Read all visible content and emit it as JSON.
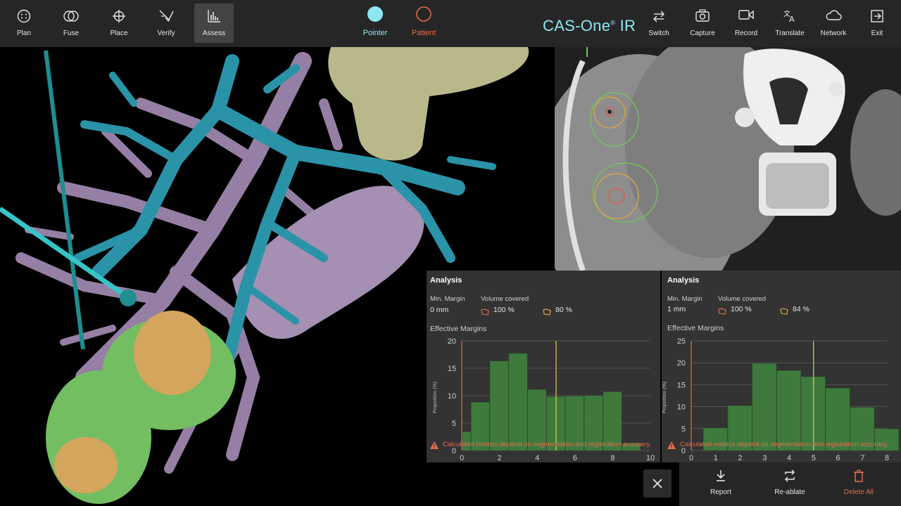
{
  "toolbar": {
    "left_buttons": [
      {
        "label": "Plan",
        "icon": "plan-icon"
      },
      {
        "label": "Fuse",
        "icon": "fuse-icon"
      },
      {
        "label": "Place",
        "icon": "crosshair-icon"
      },
      {
        "label": "Verify",
        "icon": "verify-icon"
      },
      {
        "label": "Assess",
        "icon": "bar-chart-icon",
        "active": true
      }
    ],
    "modes": [
      {
        "label": "Pointer",
        "color": "#8ee6f2",
        "selected": true
      },
      {
        "label": "Patient",
        "color": "#e46b4e",
        "selected": false
      }
    ],
    "brand": "CAS-One",
    "brand_reg": "®",
    "brand_suffix": " IR",
    "right_buttons": [
      {
        "label": "Switch",
        "icon": "switch-arrows-icon"
      },
      {
        "label": "Capture",
        "icon": "camera-icon"
      },
      {
        "label": "Record",
        "icon": "video-icon"
      },
      {
        "label": "Translate",
        "icon": "translate-icon"
      },
      {
        "label": "Network",
        "icon": "cloud-icon"
      },
      {
        "label": "Exit",
        "icon": "exit-icon"
      }
    ]
  },
  "analysis": [
    {
      "title": "Analysis",
      "min_margin_label": "Min. Margin",
      "min_margin_value": "0 mm",
      "volume_label": "Volume covered",
      "volume_red": "100 %",
      "volume_orange": "80 %",
      "effective_label": "Effective Margins",
      "warning": "Calculated metrics depend on segmentation and registration accuracy."
    },
    {
      "title": "Analysis",
      "min_margin_label": "Min. Margin",
      "min_margin_value": "1 mm",
      "volume_label": "Volume covered",
      "volume_red": "100 %",
      "volume_orange": "84 %",
      "effective_label": "Effective Margins",
      "warning": "Calculated metrics depend on segmentation and registration accuracy."
    }
  ],
  "chart_data": [
    {
      "type": "bar",
      "ylabel": "Proportion (%)",
      "xlim": [
        0,
        10
      ],
      "ylim": [
        0,
        20
      ],
      "xticks": [
        0,
        2,
        4,
        6,
        8,
        10
      ],
      "yticks": [
        0,
        5,
        10,
        15,
        20
      ],
      "bin_starts": [
        -0.5,
        0.5,
        1.5,
        2.5,
        3.5,
        4.5,
        5.5,
        6.5,
        7.5,
        8.5
      ],
      "bin_width": 1,
      "values": [
        3.4,
        8.8,
        16.3,
        17.7,
        11.1,
        9.8,
        9.9,
        10.0,
        10.7,
        1.3
      ],
      "vlines": [
        {
          "x": 0,
          "color": "#e46b4e"
        },
        {
          "x": 5,
          "color": "#e3cc4a"
        }
      ],
      "bar_color": "#3f7a3d"
    },
    {
      "type": "bar",
      "ylabel": "Proportion (%)",
      "xlim": [
        0,
        8
      ],
      "ylim": [
        0,
        25
      ],
      "xticks": [
        0,
        1,
        2,
        3,
        4,
        5,
        6,
        7,
        8
      ],
      "yticks": [
        0,
        5,
        10,
        15,
        20,
        25
      ],
      "bin_starts": [
        0.5,
        1.5,
        2.5,
        3.5,
        4.5,
        5.5,
        6.5,
        7.5
      ],
      "bin_width": 1,
      "values": [
        5.1,
        10.2,
        19.8,
        18.2,
        16.8,
        14.2,
        9.8,
        4.9
      ],
      "vlines": [
        {
          "x": 0,
          "color": "#e46b4e"
        },
        {
          "x": 5,
          "color": "#e3cc4a"
        }
      ],
      "bar_color": "#3f7a3d"
    }
  ],
  "bottom": {
    "close_icon": "close-icon",
    "buttons": [
      {
        "label": "Report",
        "icon": "download-icon",
        "color": "#e6e6e6"
      },
      {
        "label": "Re-ablate",
        "icon": "repeat-icon",
        "color": "#e6e6e6"
      },
      {
        "label": "Delete All",
        "icon": "trash-icon",
        "color": "#e46b4e"
      }
    ]
  }
}
